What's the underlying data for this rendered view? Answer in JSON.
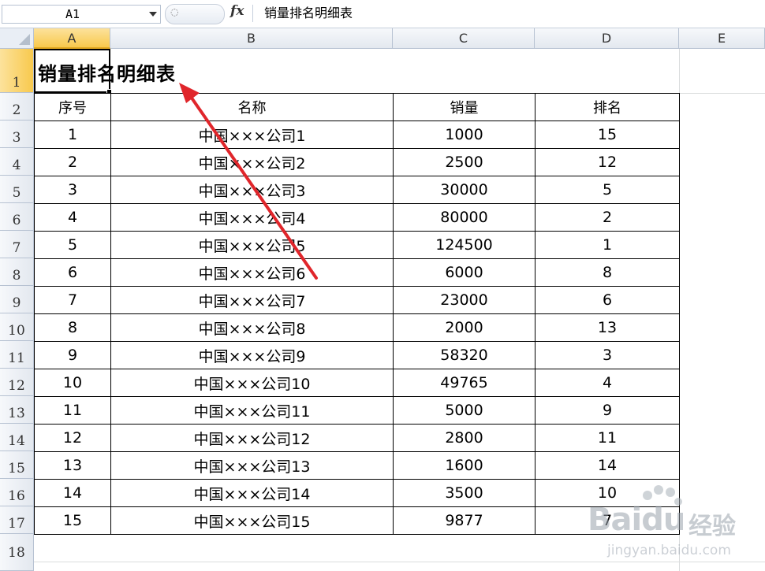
{
  "formula_bar": {
    "cell_ref": "A1",
    "fx_label": "fx",
    "value": "销量排名明细表"
  },
  "columns": [
    "A",
    "B",
    "C",
    "D",
    "E"
  ],
  "rows": [
    "1",
    "2",
    "3",
    "4",
    "5",
    "6",
    "7",
    "8",
    "9",
    "10",
    "11",
    "12",
    "13",
    "14",
    "15",
    "16",
    "17",
    "18"
  ],
  "sheet": {
    "title": "销量排名明细表",
    "headers": [
      "序号",
      "名称",
      "销量",
      "排名"
    ],
    "records": [
      [
        "1",
        "中国×××公司1",
        "1000",
        "15"
      ],
      [
        "2",
        "中国×××公司2",
        "2500",
        "12"
      ],
      [
        "3",
        "中国×××公司3",
        "30000",
        "5"
      ],
      [
        "4",
        "中国×××公司4",
        "80000",
        "2"
      ],
      [
        "5",
        "中国×××公司5",
        "124500",
        "1"
      ],
      [
        "6",
        "中国×××公司6",
        "6000",
        "8"
      ],
      [
        "7",
        "中国×××公司7",
        "23000",
        "6"
      ],
      [
        "8",
        "中国×××公司8",
        "2000",
        "13"
      ],
      [
        "9",
        "中国×××公司9",
        "58320",
        "3"
      ],
      [
        "10",
        "中国×××公司10",
        "49765",
        "4"
      ],
      [
        "11",
        "中国×××公司11",
        "5000",
        "9"
      ],
      [
        "12",
        "中国×××公司12",
        "2800",
        "11"
      ],
      [
        "13",
        "中国×××公司13",
        "1600",
        "14"
      ],
      [
        "14",
        "中国×××公司14",
        "3500",
        "10"
      ],
      [
        "15",
        "中国×××公司15",
        "9877",
        "7"
      ]
    ]
  },
  "watermark": {
    "brand": "Bai",
    "brand2": "du",
    "jingyan": "经验",
    "url": "jingyan.baidu.com"
  },
  "colors": {
    "selected_header": "#f8c94d",
    "arrow": "#e0262b",
    "gridline": "#dadcdd"
  }
}
